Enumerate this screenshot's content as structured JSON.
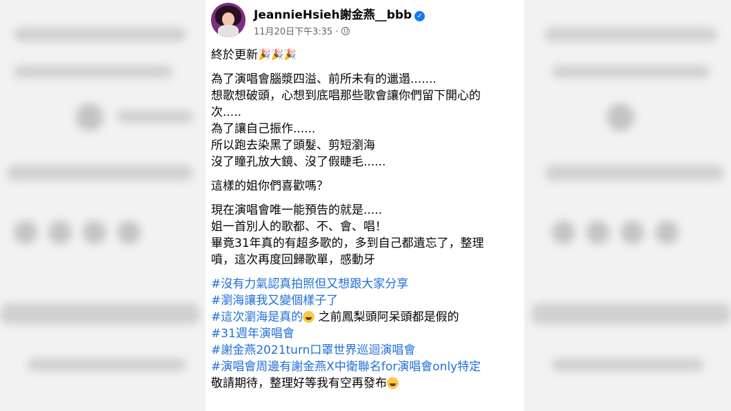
{
  "post": {
    "author": "JeannieHsieh謝金燕__bbb",
    "timestamp": "11月20日下午3:35",
    "separator": "·",
    "verified_icon": "verified-badge-icon",
    "privacy_icon": "globe-icon",
    "lines": [
      "終於更新",
      "為了演唱會腦漿四溢、前所未有的邋遢.......",
      "想歌想破頭，心想到底唱那些歌會讓你們留下開心的",
      "次.....",
      "為了讓自己振作......",
      "所以跑去染黑了頭髮、剪短瀏海",
      "沒了瞳孔放大鏡、沒了假睫毛......",
      "這樣的姐你們喜歡嗎？",
      "現在演唱會唯一能預告的就是.....",
      "姐一首別人的歌都、不、會、唱！",
      "畢竟31年真的有超多歌的，多到自己都遺忘了，整理",
      "噴，這次再度回歸歌單，感動牙"
    ],
    "hashtags": [
      "#沒有力氣認真拍照但又想跟大家分享",
      "#瀏海讓我又變個樣子了",
      "#這次瀏海是真的",
      "#31週年演唱會",
      "#謝金燕2021turn口罩世界巡迴演唱會",
      "#演唱會周邊有謝金燕X中衛聯名for演唱會only特定"
    ],
    "hashtag3_suffix": "之前鳳梨頭阿呆頭都是假的",
    "closing": "敬請期待，整理好等我有空再發布",
    "party_emoji": "🎉🎉🎉"
  }
}
